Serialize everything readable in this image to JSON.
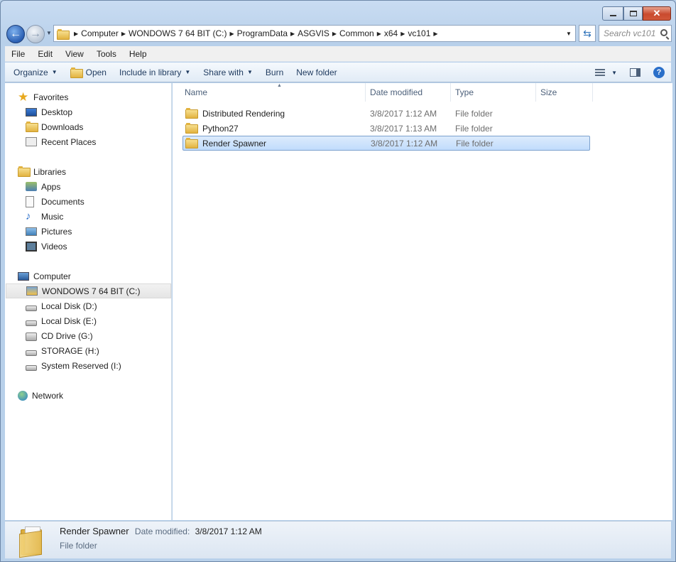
{
  "window": {
    "title": "vc101"
  },
  "address": {
    "segments": [
      "Computer",
      "WONDOWS 7 64 BIT (C:)",
      "ProgramData",
      "ASGVIS",
      "Common",
      "x64",
      "vc101"
    ]
  },
  "search": {
    "placeholder": "Search vc101"
  },
  "menu": [
    "File",
    "Edit",
    "View",
    "Tools",
    "Help"
  ],
  "toolbar": {
    "organize": "Organize",
    "open": "Open",
    "include": "Include in library",
    "share": "Share with",
    "burn": "Burn",
    "new_folder": "New folder"
  },
  "nav": {
    "favorites": {
      "label": "Favorites",
      "items": [
        "Desktop",
        "Downloads",
        "Recent Places"
      ]
    },
    "libraries": {
      "label": "Libraries",
      "items": [
        "Apps",
        "Documents",
        "Music",
        "Pictures",
        "Videos"
      ]
    },
    "computer": {
      "label": "Computer",
      "items": [
        "WONDOWS 7 64 BIT (C:)",
        "Local Disk (D:)",
        "Local Disk (E:)",
        "CD Drive (G:)",
        "STORAGE (H:)",
        "System Reserved (I:)"
      ]
    },
    "network": {
      "label": "Network"
    }
  },
  "columns": {
    "name": "Name",
    "date": "Date modified",
    "type": "Type",
    "size": "Size"
  },
  "files": [
    {
      "name": "Distributed Rendering",
      "date": "3/8/2017 1:12 AM",
      "type": "File folder"
    },
    {
      "name": "Python27",
      "date": "3/8/2017 1:13 AM",
      "type": "File folder"
    },
    {
      "name": "Render Spawner",
      "date": "3/8/2017 1:12 AM",
      "type": "File folder"
    }
  ],
  "details": {
    "name": "Render Spawner",
    "date_label": "Date modified:",
    "date_value": "3/8/2017 1:12 AM",
    "type": "File folder"
  },
  "colors": {
    "selection": "#c1dcfc",
    "selection_border": "#7da2ce",
    "accent": "#2b5fb3"
  }
}
